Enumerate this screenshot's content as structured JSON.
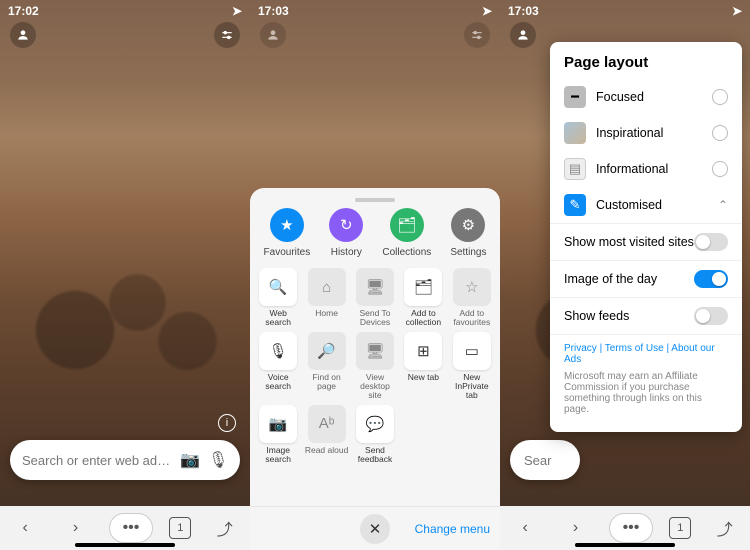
{
  "status": {
    "p1": "17:02",
    "p2": "17:03",
    "p3": "17:03",
    "loc_icon": "➤"
  },
  "top_icons": {
    "account": "account-icon",
    "slider": "adjust-icon"
  },
  "search": {
    "placeholder": "Search or enter web addre…",
    "camera": "📷",
    "mic": "🎙",
    "stub": "Sear"
  },
  "info_chip": "i",
  "bottom": {
    "back": "‹",
    "forward": "›",
    "more": "•••",
    "tabs": "1",
    "share": "⤴"
  },
  "sheet": {
    "primary": [
      {
        "label": "Favourites",
        "color": "c-fav",
        "glyph": "★"
      },
      {
        "label": "History",
        "color": "c-hist",
        "glyph": "↻"
      },
      {
        "label": "Collections",
        "color": "c-coll",
        "glyph": "🗂"
      },
      {
        "label": "Settings",
        "color": "c-set",
        "glyph": "⚙"
      }
    ],
    "grid": [
      {
        "label": "Web search",
        "glyph": "🔍",
        "active": true
      },
      {
        "label": "Home",
        "glyph": "⌂",
        "active": false
      },
      {
        "label": "Send To Devices",
        "glyph": "🖥",
        "active": false
      },
      {
        "label": "Add to collection",
        "glyph": "🗂",
        "active": true
      },
      {
        "label": "Add to favourites",
        "glyph": "☆",
        "active": false
      },
      {
        "label": "Voice search",
        "glyph": "🎙",
        "active": true
      },
      {
        "label": "Find on page",
        "glyph": "🔎",
        "active": false
      },
      {
        "label": "View desktop site",
        "glyph": "🖥",
        "active": false
      },
      {
        "label": "New tab",
        "glyph": "⊞",
        "active": true
      },
      {
        "label": "New InPrivate tab",
        "glyph": "▭",
        "active": true
      },
      {
        "label": "Image search",
        "glyph": "📷",
        "active": true
      },
      {
        "label": "Read aloud",
        "glyph": "Aᵇ",
        "active": false
      },
      {
        "label": "Send feedback",
        "glyph": "💬",
        "active": true
      }
    ],
    "close": "✕",
    "change_menu": "Change menu"
  },
  "popover": {
    "title": "Page layout",
    "options": [
      {
        "name": "Focused",
        "sw": "sw-foc",
        "glyph": "━",
        "selected": false
      },
      {
        "name": "Inspirational",
        "sw": "sw-insp",
        "glyph": "",
        "selected": false
      },
      {
        "name": "Informational",
        "sw": "sw-info",
        "glyph": "▤",
        "selected": false
      },
      {
        "name": "Customised",
        "sw": "sw-cust",
        "glyph": "✎",
        "selected": true
      }
    ],
    "toggles": [
      {
        "name": "Show most visited sites",
        "on": false
      },
      {
        "name": "Image of the day",
        "on": true
      },
      {
        "name": "Show feeds",
        "on": false
      }
    ],
    "links": {
      "privacy": "Privacy",
      "terms": "Terms of Use",
      "ads": "About our Ads",
      "sep": "  |  "
    },
    "disclaimer": "Microsoft may earn an Affiliate Commission if you purchase something through links on this page."
  }
}
